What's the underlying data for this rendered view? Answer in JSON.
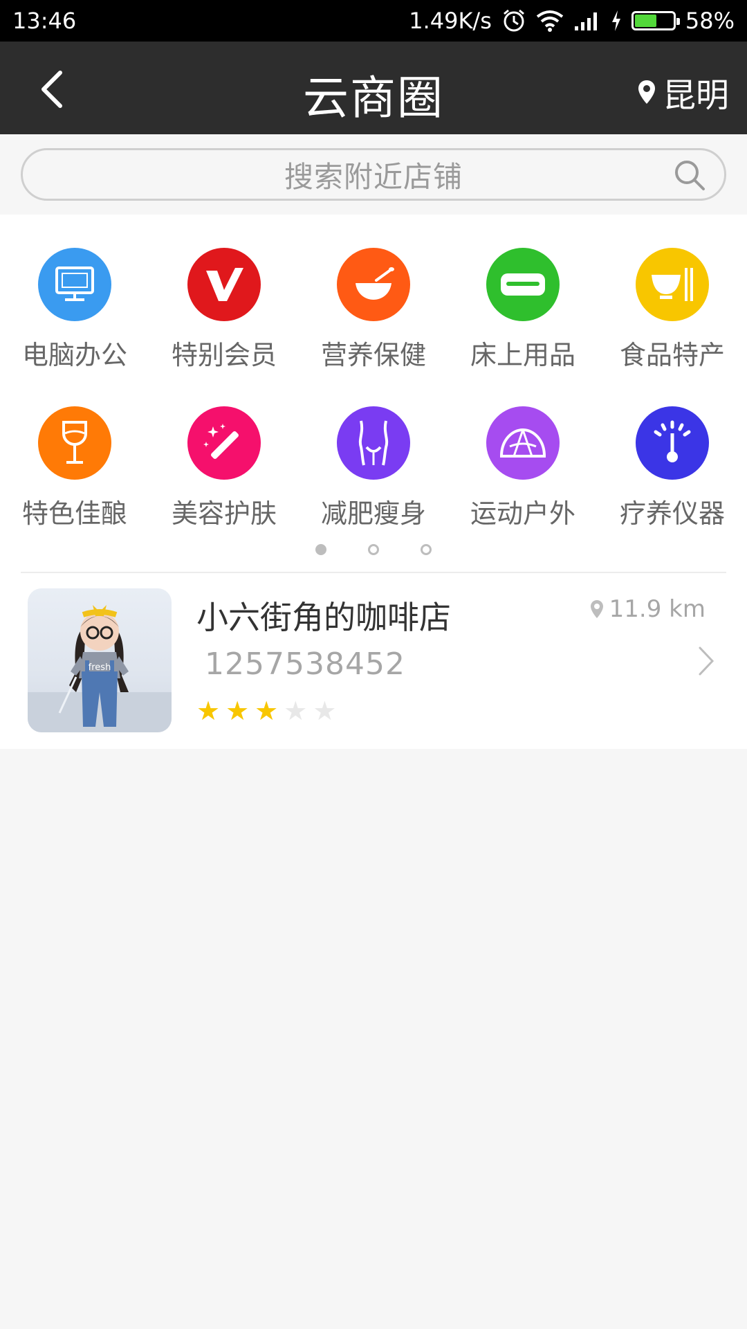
{
  "status_bar": {
    "time": "13:46",
    "speed": "1.49K/s",
    "battery": "58%",
    "battery_level": 0.58,
    "icons": [
      "alarm-icon",
      "wifi-icon",
      "signal-icon",
      "charging-icon",
      "battery-icon"
    ]
  },
  "header": {
    "title": "云商圈",
    "location": "昆明",
    "back_icon": "back-arrow-icon",
    "location_icon": "location-pin-icon"
  },
  "search": {
    "placeholder": "搜索附近店铺",
    "icon": "search-icon"
  },
  "categories": [
    {
      "label": "电脑办公",
      "color": "#3a9bf0",
      "icon": "monitor-icon"
    },
    {
      "label": "特别会员",
      "color": "#e0181c",
      "icon": "vip-icon"
    },
    {
      "label": "营养保健",
      "color": "#ff5a14",
      "icon": "bowl-spoon-icon"
    },
    {
      "label": "床上用品",
      "color": "#2fbf2d",
      "icon": "pillow-icon"
    },
    {
      "label": "食品特产",
      "color": "#f8c600",
      "icon": "bowl-chopsticks-icon"
    },
    {
      "label": "特色佳酿",
      "color": "#ff7a06",
      "icon": "wine-glass-icon"
    },
    {
      "label": "美容护肤",
      "color": "#f5106c",
      "icon": "magic-wand-icon"
    },
    {
      "label": "减肥瘦身",
      "color": "#7a3cf2",
      "icon": "body-shape-icon"
    },
    {
      "label": "运动户外",
      "color": "#a64cf0",
      "icon": "tent-icon"
    },
    {
      "label": "疗养仪器",
      "color": "#3b35e6",
      "icon": "gauge-icon"
    }
  ],
  "pagination": {
    "pages": 3,
    "active_index": 0
  },
  "stores": [
    {
      "name": "小六街角的咖啡店",
      "phone": "1257538452",
      "distance": "11.9 km",
      "rating": 3,
      "rating_max": 5,
      "thumb_text": "fresh"
    }
  ],
  "colors": {
    "app_bar": "#2d2d2d",
    "star_on": "#f8c600",
    "star_off": "#e8e8e8"
  }
}
